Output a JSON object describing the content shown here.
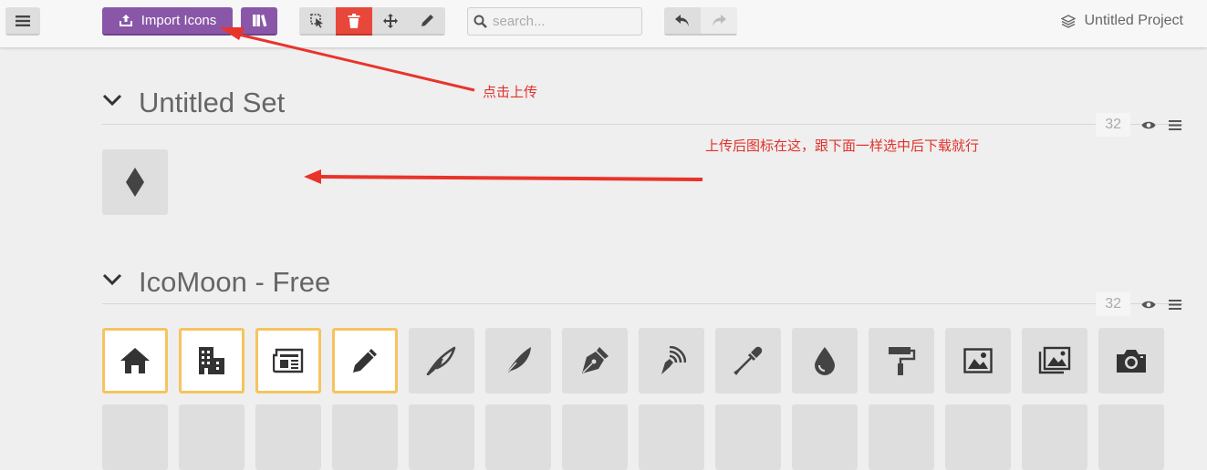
{
  "toolbar": {
    "import_label": "Import Icons",
    "search_placeholder": "search...",
    "project_name": "Untitled Project"
  },
  "sets": [
    {
      "title": "Untitled Set",
      "count": "32",
      "icons": [
        "diamond-icon"
      ]
    },
    {
      "title": "IcoMoon - Free",
      "count": "32",
      "icons": [
        "home-icon",
        "office-icon",
        "newspaper-icon",
        "pencil-icon",
        "quill-icon",
        "feather-icon",
        "pen-icon",
        "blog-icon",
        "eyedropper-icon",
        "droplet-icon",
        "paint-roller-icon",
        "image-icon",
        "images-icon",
        "camera-icon"
      ],
      "selected_count": 4
    }
  ],
  "annotations": {
    "upload_hint": "点击上传",
    "after_upload_hint": "上传后图标在这，跟下面一样选中后下载就行"
  },
  "colors": {
    "accent_purple": "#8a57a8",
    "delete_red": "#e8473b",
    "selected_border": "#f6c45f",
    "annotation_red": "#e0322a"
  }
}
